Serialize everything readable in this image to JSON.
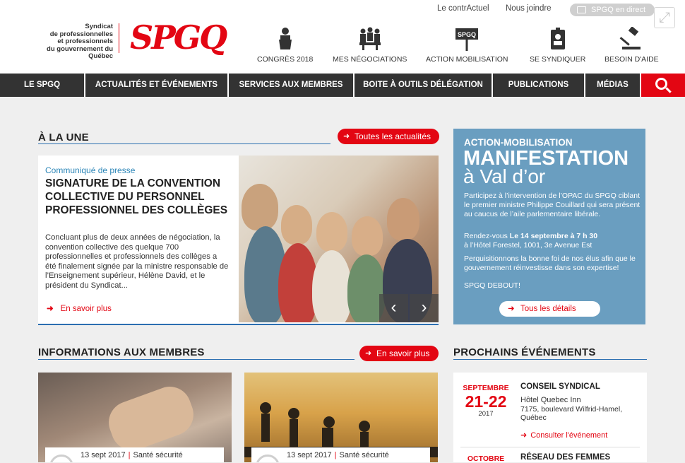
{
  "toplinks": {
    "contractuel": "Le contrActuel",
    "nous_joindre": "Nous joindre",
    "direct": "SPGQ en direct"
  },
  "logo": {
    "text_lines": [
      "Syndicat",
      "de professionnelles",
      "et professionnels",
      "du gouvernement du Québec"
    ],
    "brand": "SPGQ"
  },
  "quick_nav": [
    {
      "label": "CONGRÈS 2018",
      "icon": "podium-speaker-icon"
    },
    {
      "label": "MES NÉGOCIATIONS",
      "icon": "meeting-table-icon"
    },
    {
      "label": "ACTION MOBILISATION",
      "icon": "protest-sign-icon",
      "sign_text": "SPGQ"
    },
    {
      "label": "SE SYNDIQUER",
      "icon": "badge-person-icon"
    },
    {
      "label": "BESOIN D'AIDE",
      "icon": "gavel-icon"
    }
  ],
  "main_nav": [
    "LE SPGQ",
    "ACTUALITÉS ET ÉVÉNEMENTS",
    "SERVICES AUX MEMBRES",
    "BOITE À OUTILS DÉLÉGATION",
    "PUBLICATIONS",
    "MÉDIAS"
  ],
  "a_la_une": {
    "title": "À LA UNE",
    "button": "Toutes les actualités",
    "kicker": "Communiqué de presse",
    "headline": "SIGNATURE DE LA CONVENTION COLLECTIVE DU PERSONNEL PROFESSIONNEL DES COLLÈGES",
    "body": "Concluant plus de deux années de négociation, la convention collective des quelque 700 professionnelles et professionnels des collèges a été finalement signée par la ministre responsable de l’Enseignement supérieur, Hélène David, et le président du Syndicat...",
    "more": "En savoir plus",
    "prev": "‹",
    "next": "›"
  },
  "promo": {
    "kicker": "ACTION-MOBILISATION",
    "title1": "MANIFESTATION",
    "title2": "à Val d’or",
    "p1": "Participez à l’intervention de l’OPAC du SPGQ ciblant le premier ministre Philippe Couillard qui sera présent au caucus de l’aile parlementaire libérale.",
    "p2a": "Rendez-vous ",
    "p2b": "Le 14 septembre à 7 h 30",
    "p2c": "à l’Hôtel Forestel, 1001, 3e Avenue Est",
    "p3": "Perquisitionnons la bonne foi de nos élus afin que le gouvernement réinvestisse dans son expertise!",
    "p4": "SPGQ DEBOUT!",
    "button": "Tous les détails"
  },
  "infos": {
    "title": "INFORMATIONS AUX MEMBRES",
    "button": "En savoir plus",
    "cards": [
      {
        "date": "13 sept 2017",
        "category": "Santé sécurité"
      },
      {
        "date": "13 sept 2017",
        "category": "Santé sécurité"
      }
    ]
  },
  "events": {
    "title": "PROCHAINS ÉVÉNEMENTS",
    "items": [
      {
        "month": "SEPTEMBRE",
        "days": "21-22",
        "year": "2017",
        "title": "CONSEIL SYNDICAL",
        "loc1": "Hôtel Quebec Inn",
        "loc2": "7175, boulevard Wilfrid-Hamel,",
        "loc3": "Québec",
        "link": "Consulter l'événement"
      },
      {
        "month": "OCTOBRE",
        "title": "RÉSEAU DES FEMMES"
      }
    ]
  },
  "colors": {
    "accent": "#e30613",
    "nav": "#333333",
    "blue": "#2c6fb1",
    "promo": "#6a9ec0"
  }
}
